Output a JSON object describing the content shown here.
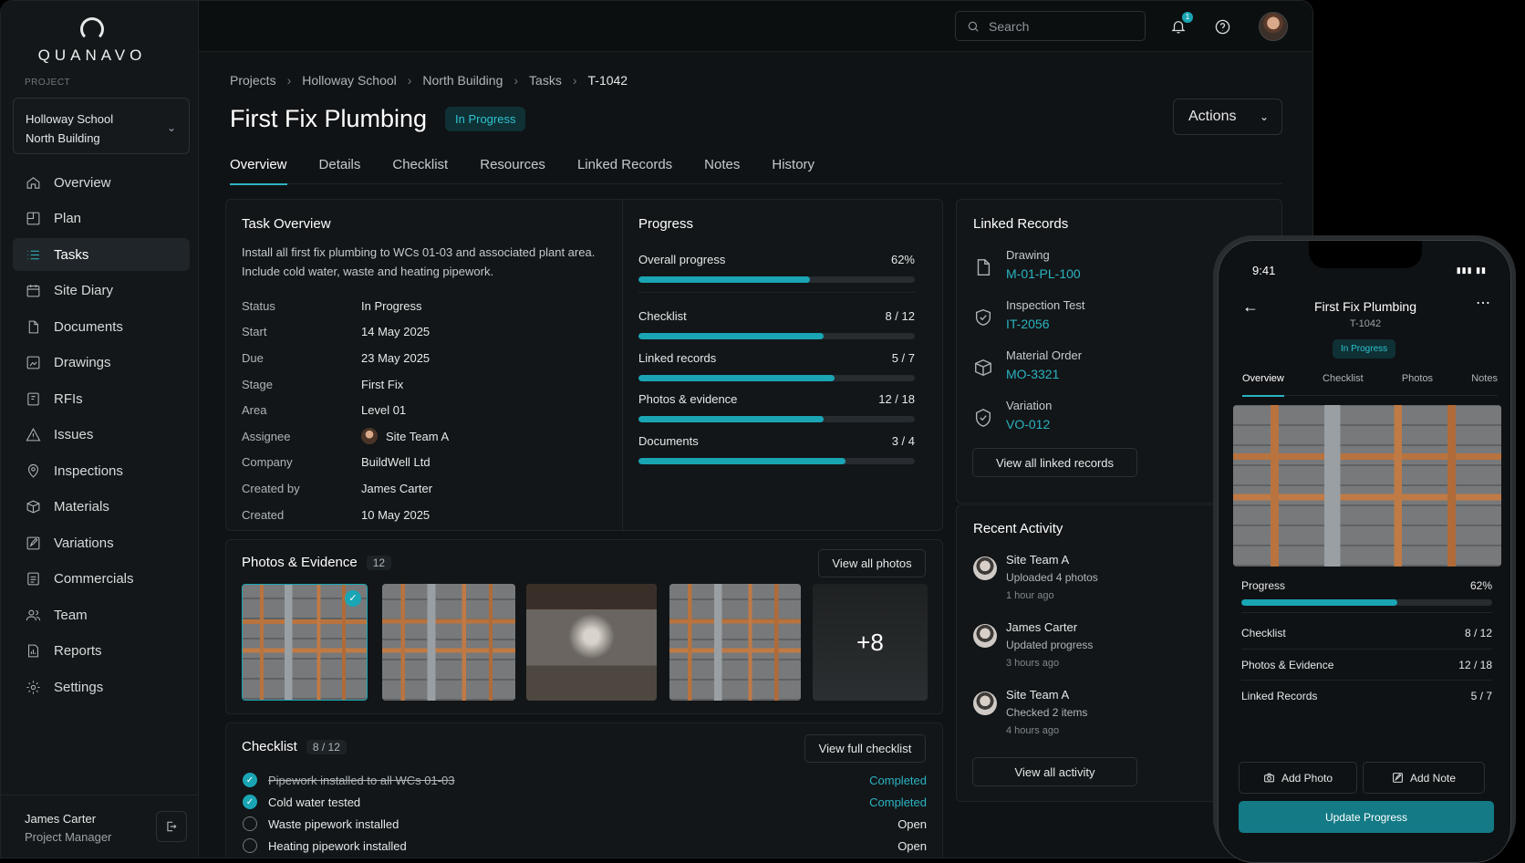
{
  "brand": {
    "name": "QUANAVO"
  },
  "sidebar": {
    "project_label": "PROJECT",
    "project_line1": "Holloway School",
    "project_line2": "North Building",
    "items": [
      {
        "label": "Overview",
        "icon": "home-icon"
      },
      {
        "label": "Plan",
        "icon": "plan-icon"
      },
      {
        "label": "Tasks",
        "icon": "tasks-icon",
        "active": true
      },
      {
        "label": "Site Diary",
        "icon": "calendar-icon"
      },
      {
        "label": "Documents",
        "icon": "document-icon"
      },
      {
        "label": "Drawings",
        "icon": "drawing-icon"
      },
      {
        "label": "RFIs",
        "icon": "rfi-icon"
      },
      {
        "label": "Issues",
        "icon": "warning-icon"
      },
      {
        "label": "Inspections",
        "icon": "inspection-icon"
      },
      {
        "label": "Materials",
        "icon": "box-icon"
      },
      {
        "label": "Variations",
        "icon": "edit-icon"
      },
      {
        "label": "Commercials",
        "icon": "commercial-icon"
      },
      {
        "label": "Team",
        "icon": "team-icon"
      },
      {
        "label": "Reports",
        "icon": "report-icon"
      },
      {
        "label": "Settings",
        "icon": "gear-icon"
      }
    ],
    "user_name": "James Carter",
    "user_role": "Project Manager"
  },
  "topbar": {
    "search_placeholder": "Search",
    "notification_count": "1"
  },
  "breadcrumb": [
    "Projects",
    "Holloway School",
    "North Building",
    "Tasks",
    "T-1042"
  ],
  "page": {
    "title": "First Fix Plumbing",
    "status": "In Progress",
    "actions_label": "Actions"
  },
  "tabs": [
    "Overview",
    "Details",
    "Checklist",
    "Resources",
    "Linked Records",
    "Notes",
    "History"
  ],
  "overview": {
    "heading": "Task Overview",
    "description": "Install all first fix plumbing to WCs 01-03 and associated plant area. Include cold water, waste and heating pipework.",
    "fields": [
      {
        "k": "Status",
        "v": "In Progress"
      },
      {
        "k": "Start",
        "v": "14 May 2025"
      },
      {
        "k": "Due",
        "v": "23 May 2025"
      },
      {
        "k": "Stage",
        "v": "First Fix"
      },
      {
        "k": "Area",
        "v": "Level 01"
      },
      {
        "k": "Assignee",
        "v": "Site Team A"
      },
      {
        "k": "Company",
        "v": "BuildWell Ltd"
      },
      {
        "k": "Created by",
        "v": "James Carter"
      },
      {
        "k": "Created",
        "v": "10 May 2025"
      }
    ]
  },
  "progress": {
    "heading": "Progress",
    "rows": [
      {
        "label": "Overall progress",
        "value": "62%",
        "fraction": 0.62
      },
      {
        "label": "Checklist",
        "value": "8 / 12",
        "fraction": 0.67
      },
      {
        "label": "Linked records",
        "value": "5 / 7",
        "fraction": 0.71
      },
      {
        "label": "Photos & evidence",
        "value": "12 / 18",
        "fraction": 0.67
      },
      {
        "label": "Documents",
        "value": "3 / 4",
        "fraction": 0.75
      }
    ]
  },
  "linked_records": {
    "heading": "Linked Records",
    "items": [
      {
        "type": "Drawing",
        "ref": "M-01-PL-100",
        "icon": "document-icon"
      },
      {
        "type": "Inspection Test",
        "ref": "IT-2056",
        "icon": "shield-check-icon"
      },
      {
        "type": "Material Order",
        "ref": "MO-3321",
        "icon": "box-icon"
      },
      {
        "type": "Variation",
        "ref": "VO-012",
        "icon": "badge-check-icon"
      }
    ],
    "view_all": "View all linked records"
  },
  "activity": {
    "heading": "Recent Activity",
    "items": [
      {
        "name": "Site Team A",
        "action": "Uploaded 4 photos",
        "time": "1 hour ago"
      },
      {
        "name": "James Carter",
        "action": "Updated progress",
        "time": "3 hours ago"
      },
      {
        "name": "Site Team A",
        "action": "Checked 2 items",
        "time": "4 hours ago"
      }
    ],
    "view_all": "View all activity"
  },
  "photos": {
    "heading": "Photos & Evidence",
    "count": "12",
    "view_all": "View all photos",
    "more": "+8"
  },
  "checklist": {
    "heading": "Checklist",
    "count": "8 / 12",
    "view_all": "View full checklist",
    "items": [
      {
        "label": "Pipework installed to all WCs 01-03",
        "status": "Completed",
        "done": true
      },
      {
        "label": "Cold water tested",
        "status": "Completed",
        "done": true
      },
      {
        "label": "Waste pipework installed",
        "status": "Open",
        "done": false
      },
      {
        "label": "Heating pipework installed",
        "status": "Open",
        "done": false
      }
    ]
  },
  "mobile": {
    "time": "9:41",
    "title": "First Fix Plumbing",
    "subtitle": "T-1042",
    "status": "In Progress",
    "tabs": [
      "Overview",
      "Checklist",
      "Photos",
      "Notes"
    ],
    "progress_label": "Progress",
    "progress_value": "62%",
    "progress_fraction": 0.62,
    "rows": [
      {
        "label": "Checklist",
        "value": "8 / 12"
      },
      {
        "label": "Photos & Evidence",
        "value": "12 / 18"
      },
      {
        "label": "Linked Records",
        "value": "5 / 7"
      }
    ],
    "add_photo": "Add Photo",
    "add_note": "Add Note",
    "update": "Update Progress"
  }
}
